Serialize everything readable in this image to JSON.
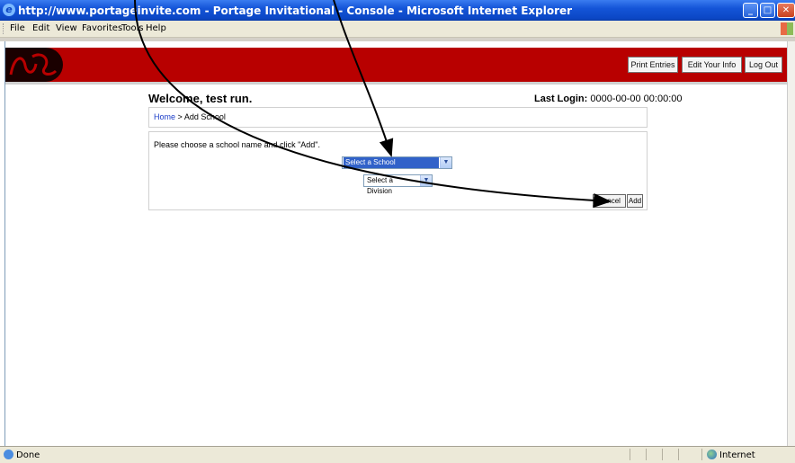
{
  "window": {
    "title": "http://www.portageinvite.com - Portage Invitational - Console - Microsoft Internet Explorer",
    "controls": [
      "minimize",
      "maximize",
      "close"
    ]
  },
  "menubar": {
    "items": [
      "File",
      "Edit",
      "View",
      "Favorites",
      "Tools",
      "Help"
    ]
  },
  "header": {
    "buttons": [
      "Print Entries",
      "Edit Your Info",
      "Log Out"
    ],
    "brand_color": "#b80000"
  },
  "page": {
    "welcome": "Welcome, test run.",
    "last_login_label": "Last Login:",
    "last_login_value": "0000-00-00 00:00:00",
    "breadcrumb": {
      "home": "Home",
      "separator": ">",
      "current": "Add School"
    },
    "form": {
      "instructions": "Please choose a school name and click \"Add\".",
      "school_select": "Select a School",
      "division_select": "Select a Division",
      "cancel_label": "Cancel",
      "add_label": "Add"
    }
  },
  "statusbar": {
    "status": "Done",
    "zone": "Internet"
  },
  "icons": {
    "page_icon": "ie-page-icon",
    "zone_icon": "globe-icon",
    "dropdown_icon": "chevron-down-icon"
  }
}
